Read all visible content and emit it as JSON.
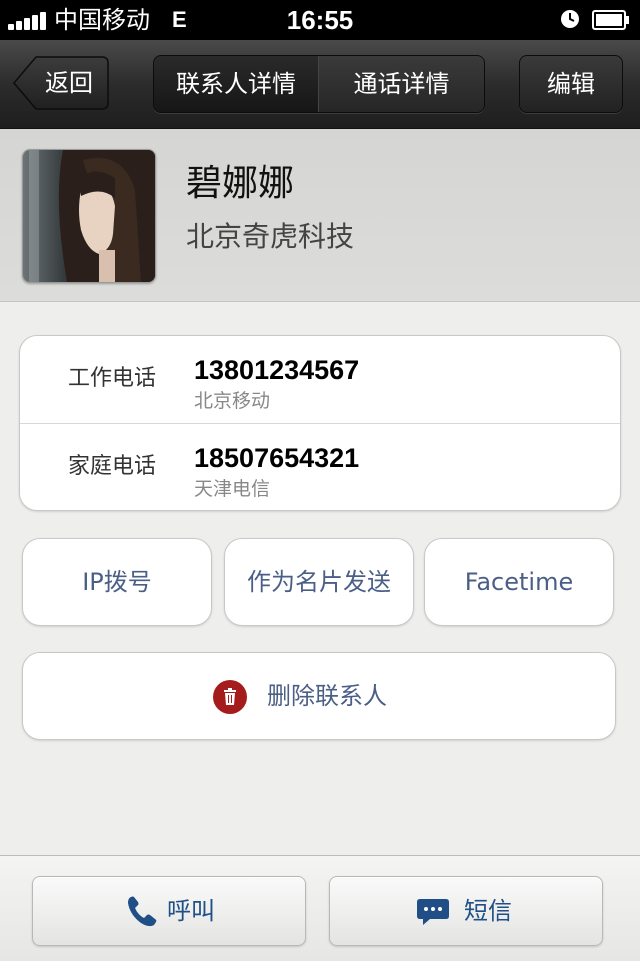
{
  "status_bar": {
    "carrier": "中国移动",
    "network": "E",
    "time": "16:55"
  },
  "nav": {
    "back_label": "返回",
    "tabs": [
      {
        "label": "联系人详情",
        "selected": true
      },
      {
        "label": "通话详情",
        "selected": false
      }
    ],
    "edit_label": "编辑"
  },
  "contact": {
    "name": "碧娜娜",
    "company": "北京奇虎科技"
  },
  "phones": [
    {
      "label": "工作电话",
      "number": "13801234567",
      "carrier": "北京移动"
    },
    {
      "label": "家庭电话",
      "number": "18507654321",
      "carrier": "天津电信"
    }
  ],
  "actions": {
    "ip_dial": "IP拨号",
    "send_card": "作为名片发送",
    "facetime": "Facetime",
    "delete": "删除联系人"
  },
  "toolbar": {
    "call": "呼叫",
    "sms": "短信"
  },
  "colors": {
    "accent_text": "#4b5f86",
    "toolbar_text": "#1f4f86",
    "delete_icon": "#a51c1c"
  },
  "icons": {
    "call": "phone-icon",
    "sms": "chat-bubble-icon",
    "delete": "trash-icon"
  }
}
